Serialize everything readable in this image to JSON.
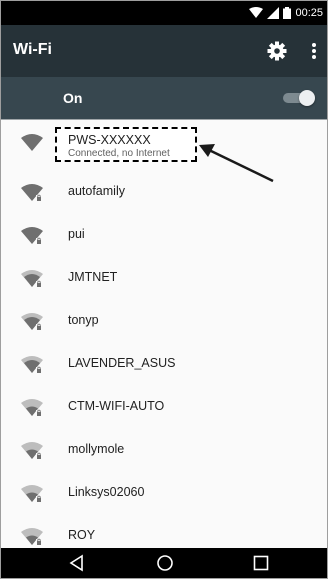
{
  "status_bar": {
    "time": "00:25",
    "icons": [
      "wifi-icon",
      "signal-icon",
      "battery-icon"
    ]
  },
  "action_bar": {
    "title": "Wi-Fi",
    "icons": [
      "gear-icon",
      "overflow-menu-icon"
    ]
  },
  "wifi_toggle": {
    "label": "On",
    "state": "on"
  },
  "networks": [
    {
      "ssid": "PWS-XXXXXX",
      "status": "Connected, no Internet",
      "icon": "wifi-full-icon"
    },
    {
      "ssid": "autofamily",
      "icon": "wifi-locked-icon"
    },
    {
      "ssid": "pui",
      "icon": "wifi-locked-icon"
    },
    {
      "ssid": "JMTNET",
      "icon": "wifi-locked-icon"
    },
    {
      "ssid": "tonyp",
      "icon": "wifi-locked-icon"
    },
    {
      "ssid": "LAVENDER_ASUS",
      "icon": "wifi-locked-icon"
    },
    {
      "ssid": "CTM-WIFI-AUTO",
      "icon": "wifi-locked-icon"
    },
    {
      "ssid": "mollymole",
      "icon": "wifi-locked-icon"
    },
    {
      "ssid": "Linksys02060",
      "icon": "wifi-locked-icon"
    },
    {
      "ssid": "ROY",
      "icon": "wifi-locked-icon"
    }
  ],
  "nav_bar": {
    "buttons": [
      "back-icon",
      "home-icon",
      "recents-icon"
    ]
  },
  "colors": {
    "action_bar": "#263238",
    "toggle_row": "#37474f",
    "list_background": "#fafafa",
    "icon_gray": "#6f6f6f"
  }
}
